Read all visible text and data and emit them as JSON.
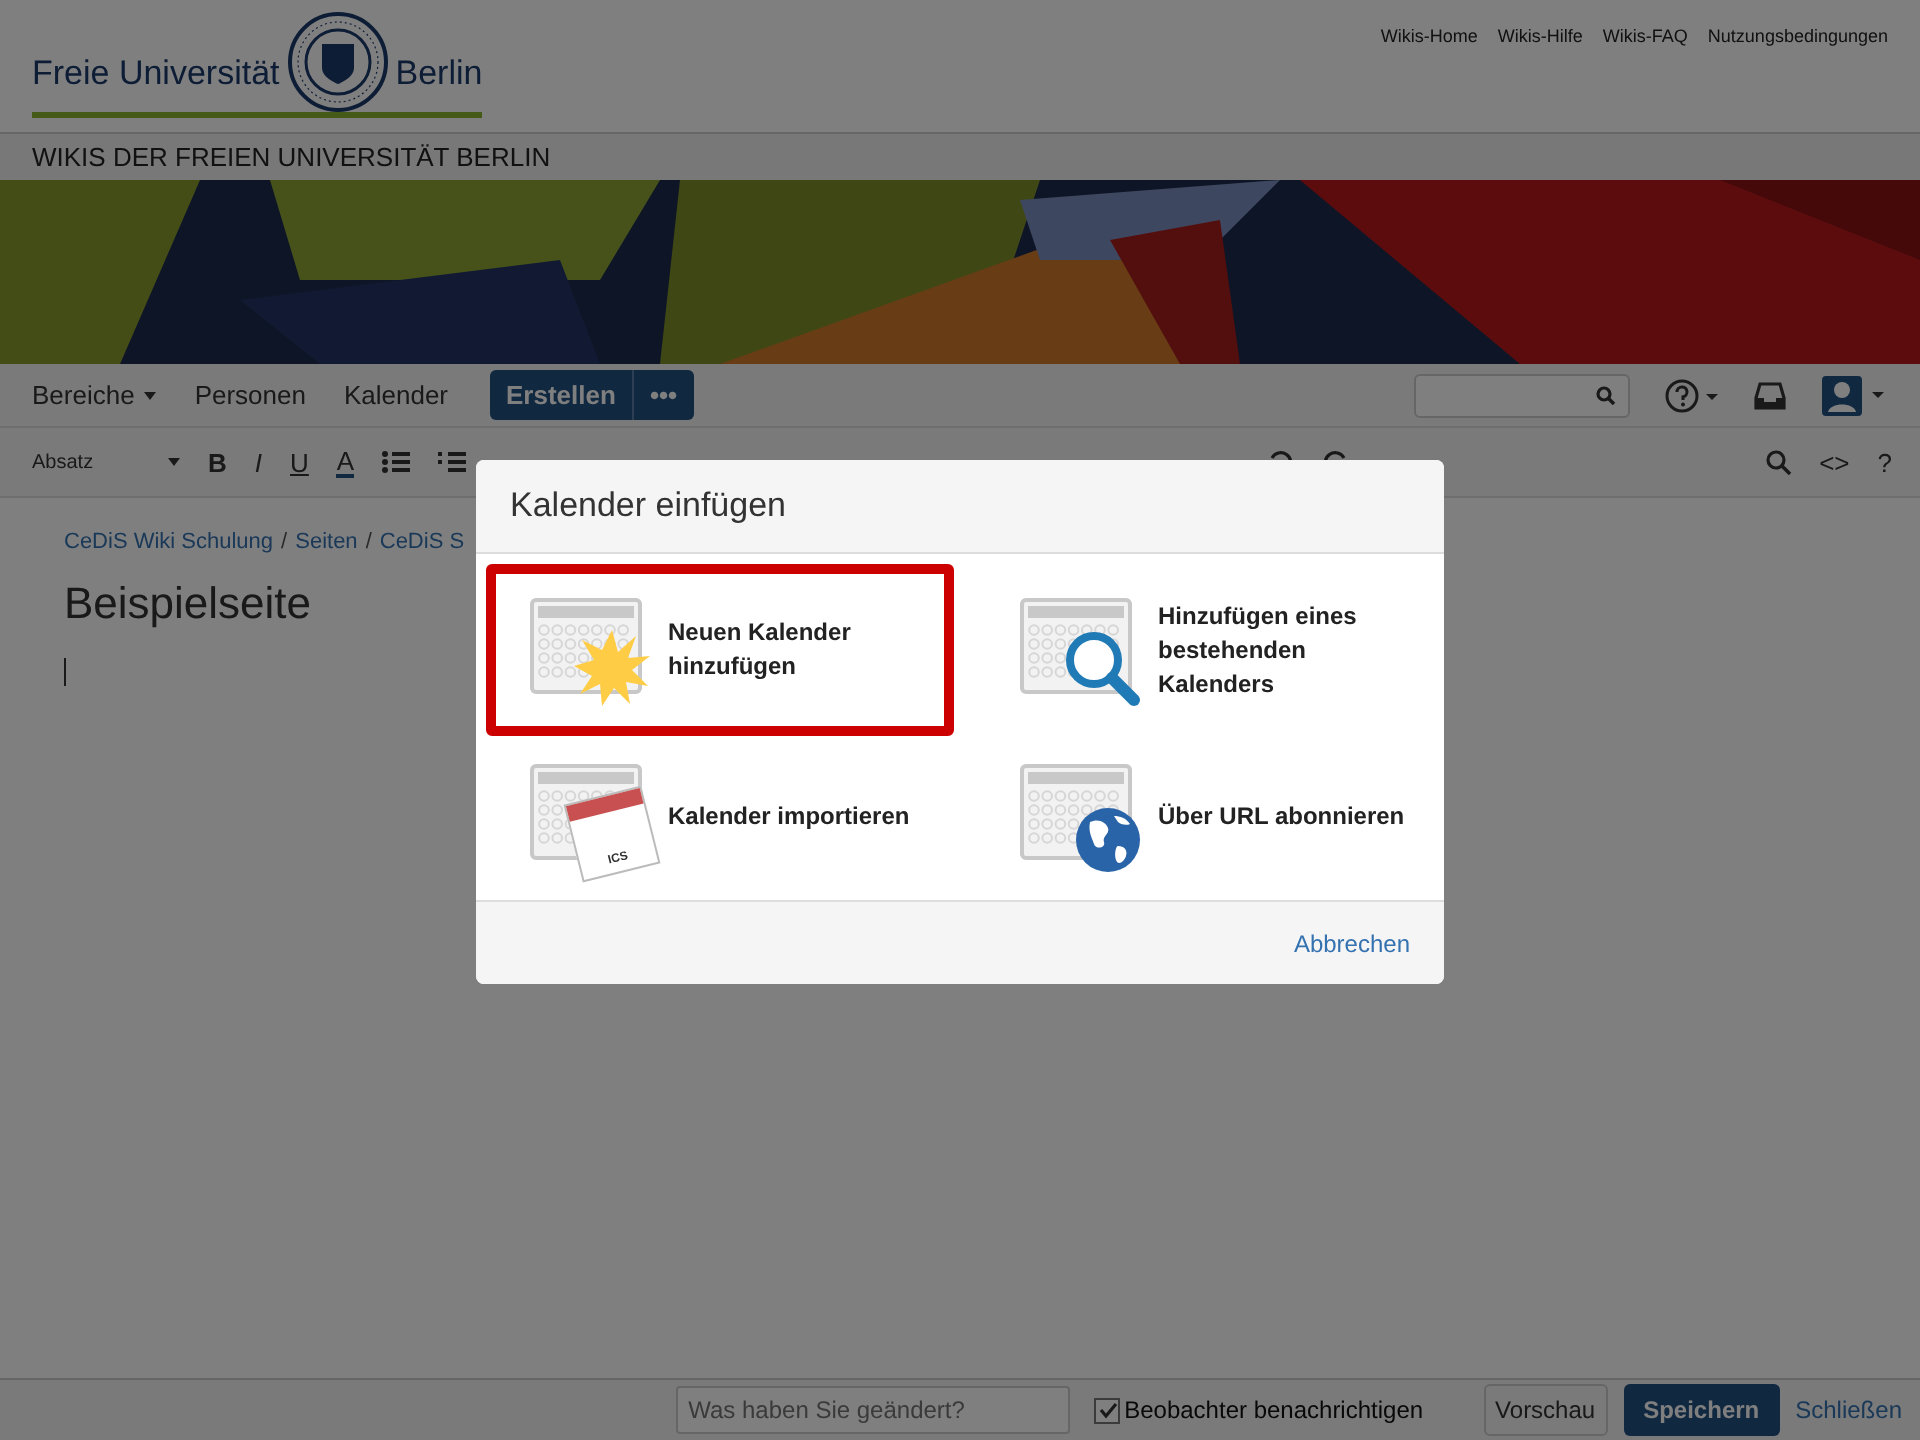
{
  "header": {
    "logo": {
      "left": "Freie Universität",
      "right": "Berlin"
    },
    "links": [
      "Wikis-Home",
      "Wikis-Hilfe",
      "Wikis-FAQ",
      "Nutzungsbedingungen"
    ]
  },
  "site_title": "WIKIS DER FREIEN UNIVERSITÄT BERLIN",
  "banner": {
    "kind": "picture"
  },
  "nav": {
    "items": [
      {
        "label": "Bereiche",
        "dropdown": true
      },
      {
        "label": "Personen",
        "dropdown": false
      },
      {
        "label": "Kalender",
        "dropdown": false
      }
    ],
    "create": "Erstellen",
    "more": "•••"
  },
  "toolbar": {
    "style_select": "Absatz",
    "format": [
      "B",
      "I",
      "U",
      "A"
    ],
    "right": [
      "<>",
      "?"
    ]
  },
  "breadcrumbs": [
    "CeDiS Wiki Schulung",
    "Seiten",
    "CeDiS S"
  ],
  "breadcrumb_separators": [
    "/",
    "/"
  ],
  "page_title": "Beispielseite",
  "dialog": {
    "title": "Kalender einfügen",
    "options": [
      {
        "kind": "new",
        "label": "Neuen Kalender hinzufügen",
        "selected": true
      },
      {
        "kind": "search",
        "label": "Hinzufügen eines bestehenden Kalenders",
        "selected": false
      },
      {
        "kind": "import",
        "label": "Kalender importieren",
        "badge": "ICS",
        "selected": false
      },
      {
        "kind": "subscribe",
        "label": "Über URL abonnieren",
        "selected": false
      }
    ],
    "cancel": "Abbrechen"
  },
  "footer": {
    "comment": {
      "placeholder": "Was haben Sie geändert?"
    },
    "notify": {
      "label": "Beobachter benachrichtigen",
      "checked": true
    },
    "preview": "Vorschau",
    "save": "Speichern",
    "close": "Schließen"
  }
}
